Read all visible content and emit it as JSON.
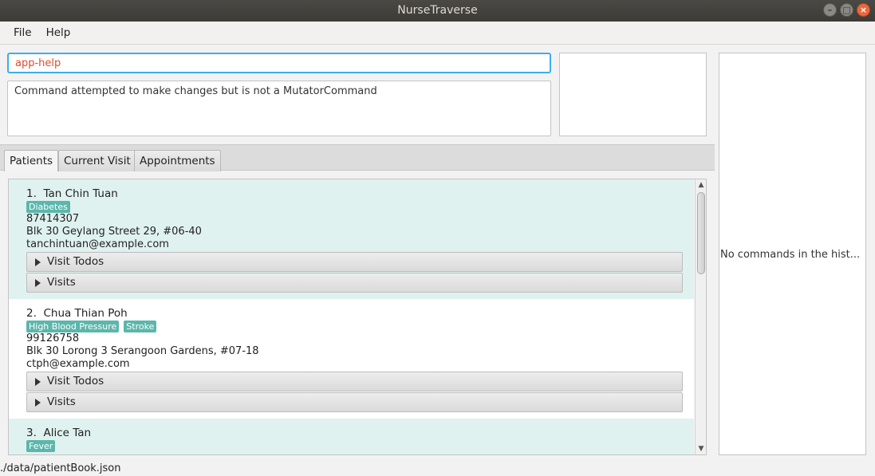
{
  "window": {
    "title": "NurseTraverse"
  },
  "menu": {
    "file": "File",
    "help": "Help"
  },
  "command": {
    "value": "app-help"
  },
  "result": {
    "text": "Command attempted to make changes but is not a MutatorCommand"
  },
  "history": {
    "empty_text": "No commands in the hist..."
  },
  "tabs": [
    "Patients",
    "Current Visit",
    "Appointments"
  ],
  "patients": [
    {
      "index": "1.",
      "name": "Tan Chin Tuan",
      "tags": [
        "Diabetes"
      ],
      "phone": "87414307",
      "address": "Blk 30 Geylang Street 29, #06-40",
      "email": "tanchintuan@example.com",
      "visit_todos": "Visit Todos",
      "visits": "Visits"
    },
    {
      "index": "2.",
      "name": "Chua Thian Poh",
      "tags": [
        "High Blood Pressure",
        "Stroke"
      ],
      "phone": "99126758",
      "address": "Blk 30 Lorong 3 Serangoon Gardens, #07-18",
      "email": "ctph@example.com",
      "visit_todos": "Visit Todos",
      "visits": "Visits"
    },
    {
      "index": "3.",
      "name": "Alice Tan",
      "tags": [
        "Fever"
      ]
    }
  ],
  "status": {
    "path": "./data/patientBook.json"
  },
  "colors": {
    "tag": "#5cb6ab",
    "focus": "#3daee9",
    "command_text": "#e04b29",
    "card_alt": "#dff2ef"
  }
}
